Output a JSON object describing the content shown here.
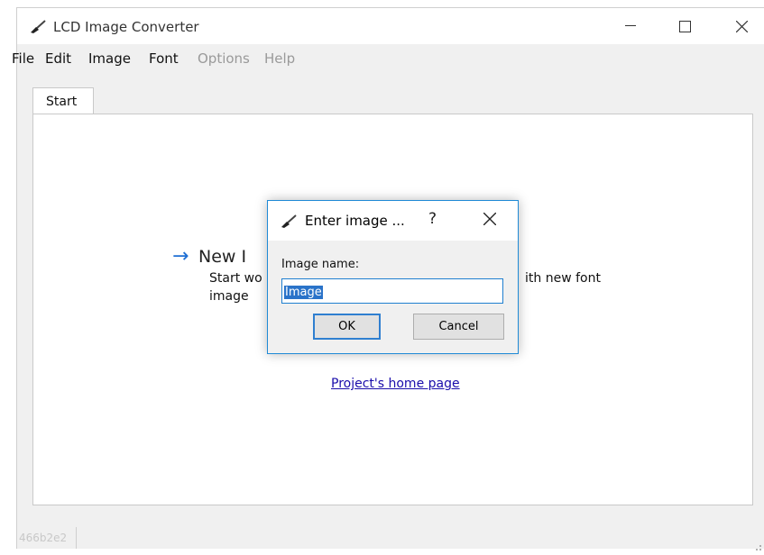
{
  "window": {
    "title": "LCD Image Converter"
  },
  "menu": {
    "items": [
      {
        "label": "File",
        "enabled": true
      },
      {
        "label": "Edit",
        "enabled": true
      },
      {
        "label": "Image",
        "enabled": true
      },
      {
        "label": "Font",
        "enabled": true
      },
      {
        "label": "Options",
        "enabled": false
      },
      {
        "label": "Help",
        "enabled": false
      }
    ]
  },
  "tabs": [
    {
      "label": "Start",
      "active": true
    }
  ],
  "start_page": {
    "new_image_title": "New I",
    "new_image_desc_line1": "Start wo",
    "new_image_desc_line2": "image",
    "new_font_desc": "ith new font",
    "home_link": "Project's home page"
  },
  "status": {
    "text": "466b2e2"
  },
  "dialog": {
    "title": "Enter image ...",
    "help": "?",
    "label": "Image name:",
    "input_value": "Image",
    "ok_label": "OK",
    "cancel_label": "Cancel"
  },
  "colors": {
    "accent": "#1f8ad6",
    "link": "#1a0dab",
    "selection": "#2a73c9",
    "arrow": "#1f6fd4"
  }
}
